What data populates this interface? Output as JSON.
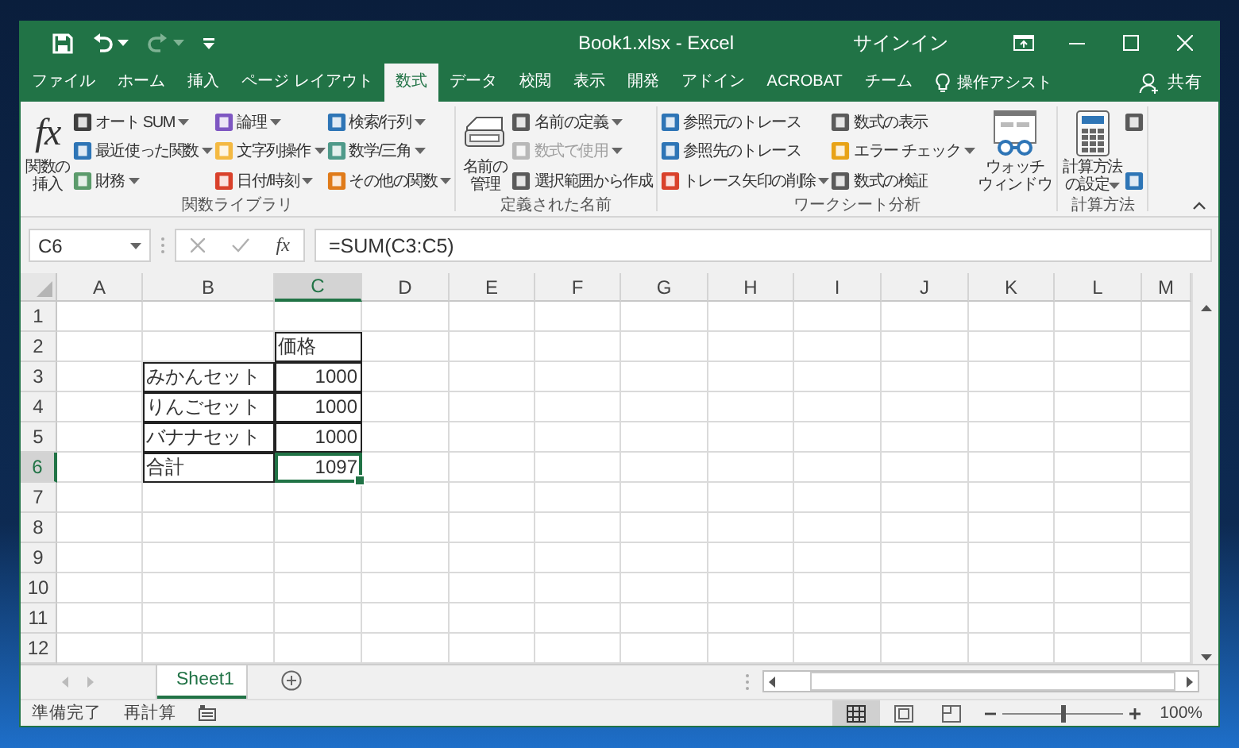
{
  "window": {
    "title": "Book1.xlsx  -  Excel",
    "sign_in": "サインイン"
  },
  "quick_access": [
    {
      "kind": "save",
      "disabled": false,
      "dropdown": false
    },
    {
      "kind": "undo",
      "disabled": false,
      "dropdown": true
    },
    {
      "kind": "redo",
      "disabled": true,
      "dropdown": true
    },
    {
      "kind": "customize",
      "disabled": false,
      "dropdown": false
    }
  ],
  "tabs": [
    {
      "label": "ファイル",
      "selected": false
    },
    {
      "label": "ホーム",
      "selected": false
    },
    {
      "label": "挿入",
      "selected": false
    },
    {
      "label": "ページ レイアウト",
      "selected": false
    },
    {
      "label": "数式",
      "selected": true
    },
    {
      "label": "データ",
      "selected": false
    },
    {
      "label": "校閲",
      "selected": false
    },
    {
      "label": "表示",
      "selected": false
    },
    {
      "label": "開発",
      "selected": false
    },
    {
      "label": "アドイン",
      "selected": false
    },
    {
      "label": "ACROBAT",
      "selected": false
    },
    {
      "label": "チーム",
      "selected": false
    }
  ],
  "tell_me": "操作アシスト",
  "share": "共有",
  "ribbon": {
    "groups": [
      {
        "label": "関数ライブラリ",
        "items": [
          {
            "kind": "large",
            "glyph": "fx",
            "lines": [
              "関数の",
              "挿入"
            ],
            "dropdown": false
          },
          {
            "kind": "stack",
            "buttons": [
              {
                "label": "オート SUM",
                "color": "#404040",
                "dropdown": true,
                "disabled": false
              },
              {
                "label": "最近使った関数",
                "color": "#2e75b6",
                "dropdown": true,
                "disabled": false
              },
              {
                "label": "財務",
                "color": "#5b9b6b",
                "dropdown": true,
                "disabled": false
              }
            ]
          },
          {
            "kind": "stack",
            "buttons": [
              {
                "label": "論理",
                "color": "#7e57c2",
                "dropdown": true,
                "disabled": false
              },
              {
                "label": "文字列操作",
                "color": "#f4b942",
                "dropdown": true,
                "disabled": false
              },
              {
                "label": "日付/時刻",
                "color": "#d9412b",
                "dropdown": true,
                "disabled": false
              }
            ]
          },
          {
            "kind": "stack",
            "buttons": [
              {
                "label": "検索/行列",
                "color": "#2e75b6",
                "dropdown": true,
                "disabled": false
              },
              {
                "label": "数学/三角",
                "color": "#4f9a8a",
                "dropdown": true,
                "disabled": false
              },
              {
                "label": "その他の関数",
                "color": "#e07b1a",
                "dropdown": true,
                "disabled": false
              }
            ]
          }
        ]
      },
      {
        "label": "定義された名前",
        "items": [
          {
            "kind": "large",
            "lines": [
              "名前の",
              "管理"
            ],
            "dropdown": false
          },
          {
            "kind": "stack",
            "buttons": [
              {
                "label": "名前の定義",
                "color": "#5a5a5a",
                "dropdown": true,
                "disabled": false
              },
              {
                "label": "数式で使用",
                "color": "#b8b8b8",
                "dropdown": true,
                "disabled": true
              },
              {
                "label": "選択範囲から作成",
                "color": "#5a5a5a",
                "dropdown": false,
                "disabled": false
              }
            ]
          }
        ]
      },
      {
        "label": "ワークシート分析",
        "items": [
          {
            "kind": "stack",
            "buttons": [
              {
                "label": "参照元のトレース",
                "color": "#2e75b6",
                "dropdown": false,
                "disabled": false
              },
              {
                "label": "参照先のトレース",
                "color": "#2e75b6",
                "dropdown": false,
                "disabled": false
              },
              {
                "label": "トレース矢印の削除",
                "color": "#d9412b",
                "dropdown": true,
                "disabled": false
              }
            ]
          },
          {
            "kind": "stack",
            "buttons": [
              {
                "label": "数式の表示",
                "color": "#5a5a5a",
                "dropdown": false,
                "disabled": false
              },
              {
                "label": "エラー チェック",
                "color": "#e8a317",
                "dropdown": true,
                "disabled": false
              },
              {
                "label": "数式の検証",
                "color": "#5a5a5a",
                "dropdown": false,
                "disabled": false
              }
            ]
          },
          {
            "kind": "large",
            "lines": [
              "ウォッチ",
              "ウィンドウ"
            ],
            "dropdown": false
          }
        ]
      },
      {
        "label": "計算方法",
        "items": [
          {
            "kind": "large",
            "lines": [
              "計算方法",
              "の設定"
            ],
            "dropdown": true
          },
          {
            "kind": "stack",
            "buttons": [
              {
                "color": "#5a5a5a",
                "dropdown": false
              },
              {
                "color": "#2e75b6",
                "dropdown": false
              }
            ]
          }
        ]
      }
    ]
  },
  "formula_bar": {
    "name_box": "C6",
    "cancel_disabled": true,
    "enter_disabled": true,
    "insert_function": "fx",
    "formula": "=SUM(C3:C5)"
  },
  "sheet": {
    "columns": [
      {
        "label": "A",
        "selected": false
      },
      {
        "label": "B",
        "selected": false
      },
      {
        "label": "C",
        "selected": true
      },
      {
        "label": "D",
        "selected": false
      },
      {
        "label": "E",
        "selected": false
      },
      {
        "label": "F",
        "selected": false
      },
      {
        "label": "G",
        "selected": false
      },
      {
        "label": "H",
        "selected": false
      },
      {
        "label": "I",
        "selected": false
      },
      {
        "label": "J",
        "selected": false
      },
      {
        "label": "K",
        "selected": false
      },
      {
        "label": "L",
        "selected": false
      },
      {
        "label": "M",
        "selected": false
      }
    ],
    "rows": [
      {
        "label": "1",
        "selected": false
      },
      {
        "label": "2",
        "selected": false,
        "cells": [
          null,
          null,
          {
            "text": "価格",
            "kind": "text",
            "bordered": true
          }
        ]
      },
      {
        "label": "3",
        "selected": false,
        "cells": [
          null,
          {
            "text": "みかんセット",
            "kind": "text",
            "bordered": true
          },
          {
            "text": "1000",
            "kind": "number",
            "bordered": true
          }
        ]
      },
      {
        "label": "4",
        "selected": false,
        "cells": [
          null,
          {
            "text": "りんごセット",
            "kind": "text",
            "bordered": true
          },
          {
            "text": "1000",
            "kind": "number",
            "bordered": true
          }
        ]
      },
      {
        "label": "5",
        "selected": false,
        "cells": [
          null,
          {
            "text": "バナナセット",
            "kind": "text",
            "bordered": true
          },
          {
            "text": "1000",
            "kind": "number",
            "bordered": true
          }
        ]
      },
      {
        "label": "6",
        "selected": true,
        "cells": [
          null,
          {
            "text": "合計",
            "kind": "text",
            "bordered": true
          },
          {
            "text": "1097",
            "kind": "number",
            "bordered": true
          }
        ]
      },
      {
        "label": "7",
        "selected": false
      },
      {
        "label": "8",
        "selected": false
      },
      {
        "label": "9",
        "selected": false
      },
      {
        "label": "10",
        "selected": false
      },
      {
        "label": "11",
        "selected": false
      },
      {
        "label": "12",
        "selected": false
      }
    ]
  },
  "sheet_tabs": [
    {
      "label": "Sheet1",
      "selected": true
    }
  ],
  "status_bar": {
    "mode": "準備完了",
    "calc": "再計算",
    "views": [
      {
        "selected": true
      },
      {
        "selected": false
      },
      {
        "selected": false
      }
    ],
    "zoom": {
      "level": 0.5,
      "reading": "100%"
    }
  }
}
